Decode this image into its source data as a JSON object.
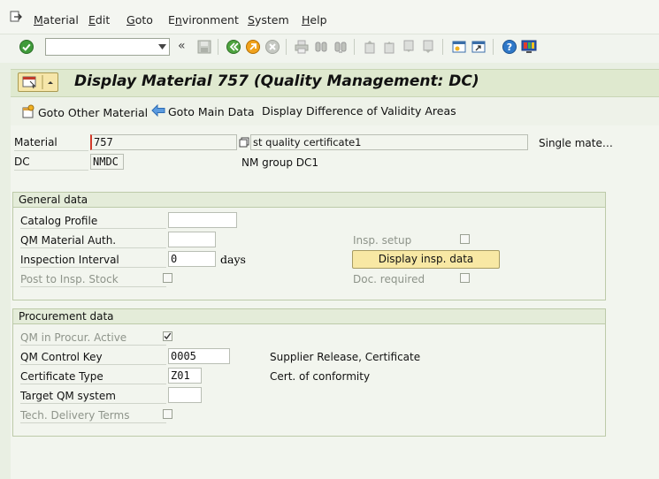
{
  "menu": {
    "items": [
      {
        "label": "Material",
        "underline": "M"
      },
      {
        "label": "Edit",
        "underline": "E"
      },
      {
        "label": "Goto",
        "underline": "G"
      },
      {
        "label": "Environment",
        "underline": "n"
      },
      {
        "label": "System",
        "underline": "S"
      },
      {
        "label": "Help",
        "underline": "H"
      }
    ]
  },
  "toolbar": {
    "command_field_value": "",
    "icons": [
      "enter-check-icon",
      "back-icon",
      "exit-icon",
      "cancel-icon",
      "print-icon",
      "find-icon",
      "find-next-icon",
      "first-page-icon",
      "prev-page-icon",
      "next-page-icon",
      "last-page-icon",
      "new-session-icon",
      "shortcut-icon",
      "help-icon",
      "customize-layout-icon"
    ]
  },
  "title": {
    "text": "Display Material 757 (Quality Management: DC)"
  },
  "app_toolbar": {
    "goto_other_material": "Goto Other Material",
    "goto_main_data": "Goto Main Data",
    "display_difference": "Display Difference of Validity Areas"
  },
  "header": {
    "material_label": "Material",
    "material_value": "757",
    "material_description": "st quality certificate1",
    "material_type_text": "Single mate…",
    "dc_label": "DC",
    "dc_value": "NMDC",
    "dc_description": "NM group DC1"
  },
  "general_data": {
    "title": "General data",
    "catalog_profile_label": "Catalog Profile",
    "catalog_profile_value": "",
    "qm_material_auth_label": "QM Material Auth.",
    "qm_material_auth_value": "",
    "inspection_interval_label": "Inspection Interval",
    "inspection_interval_value": "0",
    "inspection_interval_unit": "days",
    "post_to_insp_stock_label": "Post to Insp. Stock",
    "post_to_insp_stock_checked": false,
    "insp_setup_label": "Insp. setup",
    "insp_setup_checked": false,
    "display_insp_data_button": "Display insp. data",
    "doc_required_label": "Doc. required",
    "doc_required_checked": false
  },
  "procurement_data": {
    "title": "Procurement data",
    "qm_in_procur_active_label": "QM in Procur. Active",
    "qm_in_procur_active_checked": true,
    "qm_control_key_label": "QM Control Key",
    "qm_control_key_value": "0005",
    "qm_control_key_text": "Supplier Release, Certificate",
    "certificate_type_label": "Certificate Type",
    "certificate_type_value": "Z01",
    "certificate_type_text": "Cert. of conformity",
    "target_qm_system_label": "Target QM system",
    "target_qm_system_value": "",
    "tech_delivery_terms_label": "Tech. Delivery Terms",
    "tech_delivery_terms_checked": false
  },
  "colors": {
    "background": "#e9efe3",
    "title_bar": "#dfe9cf",
    "button_yellow": "#f8e8a4",
    "group_header": "#e4ecd9"
  }
}
